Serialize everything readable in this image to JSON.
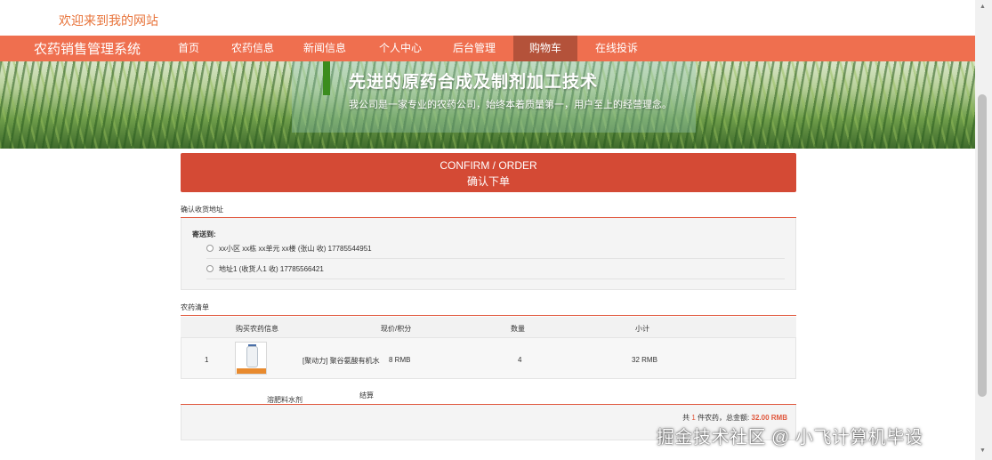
{
  "header": {
    "welcome": "欢迎来到我的网站"
  },
  "nav": {
    "brand": "农药销售管理系统",
    "items": [
      {
        "label": "首页"
      },
      {
        "label": "农药信息"
      },
      {
        "label": "新闻信息"
      },
      {
        "label": "个人中心"
      },
      {
        "label": "后台管理"
      },
      {
        "label": "购物车"
      },
      {
        "label": "在线投诉"
      }
    ],
    "active_item": "购物车"
  },
  "banner": {
    "title": "先进的原药合成及制剂加工技术",
    "subtitle": "我公司是一家专业的农药公司，始终本着质量第一，用户至上的经营理念。"
  },
  "confirm": {
    "title_en": "CONFIRM / ORDER",
    "title_cn": "确认下单"
  },
  "address": {
    "section_label": "确认收货地址",
    "send_to": "寄送到:",
    "options": [
      {
        "text": "xx小区 xx栋 xx单元 xx楼  (张山 收)  17785544951"
      },
      {
        "text": "地址1  (收货人1 收)  17785566421"
      }
    ]
  },
  "goods": {
    "section_label": "农药清单",
    "headers": {
      "info": "购买农药信息",
      "price": "现价/积分",
      "qty": "数量",
      "subtotal": "小计"
    },
    "rows": [
      {
        "index": "1",
        "name": "[聚动力] 聚谷氨酸有机水",
        "price": "8 RMB",
        "qty": "4",
        "subtotal": "32 RMB"
      }
    ],
    "extra_text": "溶肥料水剂",
    "checkout_label": "结算"
  },
  "summary": {
    "prefix": "共",
    "count": "1",
    "middle": "件农药，总金额:",
    "amount": "32.00 RMB"
  },
  "watermark": "掘金技术社区 @ 小飞计算机毕设",
  "colors": {
    "accent": "#ef6f4f",
    "active_nav": "#b4523a",
    "confirm_bg": "#d44a35",
    "welcome_text": "#e8743b"
  }
}
